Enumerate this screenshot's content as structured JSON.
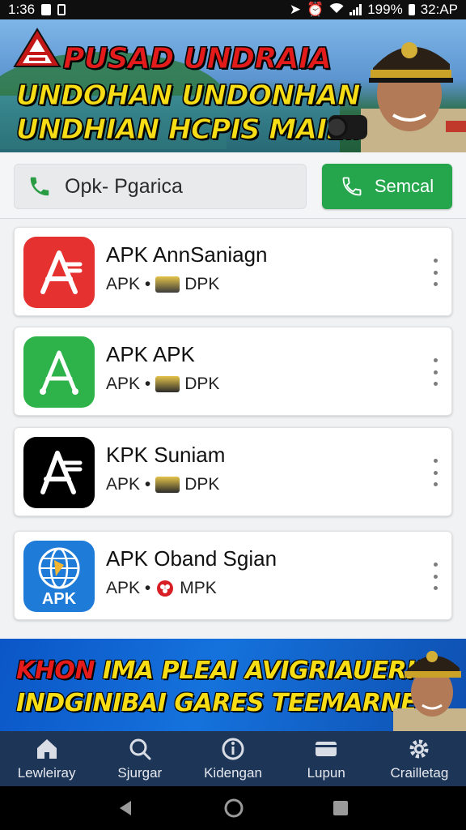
{
  "status_bar": {
    "time": "1:36",
    "battery": "199%",
    "clock_right": "32:AP"
  },
  "banner_top": {
    "line1": "PUSAD UNDRAIA",
    "line2": "UNDOHAN UNDONHAN",
    "line3": "UNDHIAN HCPIS MAILIAI"
  },
  "search": {
    "field_value": "Opk- Pgarica",
    "button_label": "Semcal"
  },
  "apps": [
    {
      "title": "APK AnnSaniagn",
      "sub_prefix": "APK •",
      "sub_suffix": "DPK",
      "icon": "app-store-icon",
      "color": "#e5312f"
    },
    {
      "title": "APK APK",
      "sub_prefix": "APK •",
      "sub_suffix": "DPK",
      "icon": "app-store-icon",
      "color": "#2db34a"
    },
    {
      "title": "KPK Suniam",
      "sub_prefix": "APK •",
      "sub_suffix": "DPK",
      "icon": "app-store-icon",
      "color": "#000000"
    },
    {
      "title": "APK Oband Sgian",
      "sub_prefix": "APK •",
      "sub_suffix": "MPK",
      "icon": "globe-icon",
      "color": "#1f7bd8",
      "icon_text": "APK"
    }
  ],
  "banner_bottom": {
    "line1_red": "KHON",
    "line1_rest": " IMA PLEAI AVIGRIAUERIN",
    "line2": "INDGINIBAI GARES TEEMARNEI!"
  },
  "bottom_nav": [
    {
      "label": "Lewleiray",
      "icon": "home-icon"
    },
    {
      "label": "Sjurgar",
      "icon": "search-icon"
    },
    {
      "label": "Kidengan",
      "icon": "info-icon"
    },
    {
      "label": "Lupun",
      "icon": "card-icon"
    },
    {
      "label": "Crailletag",
      "icon": "gear-icon"
    }
  ],
  "colors": {
    "accent_green": "#25a54c",
    "nav_bg": "#1d3557",
    "banner_yellow": "#f7dd16",
    "banner_red": "#e41b1b"
  }
}
